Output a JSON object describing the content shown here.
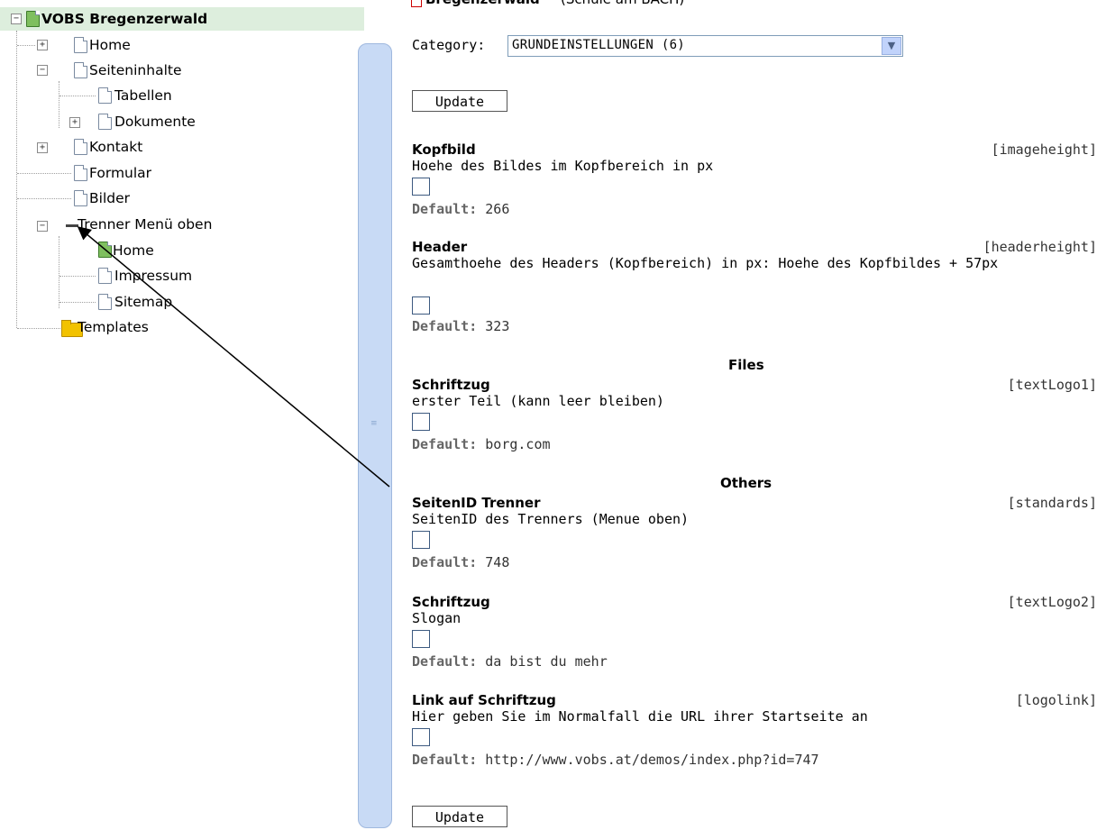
{
  "tree": {
    "root": "VOBS Bregenzerwald",
    "items": [
      {
        "label": "Home"
      },
      {
        "label": "Seiteninhalte"
      },
      {
        "label": "Tabellen"
      },
      {
        "label": "Dokumente"
      },
      {
        "label": "Kontakt"
      },
      {
        "label": "Formular"
      },
      {
        "label": "Bilder"
      },
      {
        "label": "Trenner Menü oben"
      },
      {
        "label": "Home"
      },
      {
        "label": "Impressum"
      },
      {
        "label": "Sitemap"
      },
      {
        "label": "Templates"
      }
    ]
  },
  "content": {
    "top_title": "Bregenzerwald",
    "top_title_suffix": "(Schule am BACH)",
    "category_label": "Category:",
    "category_value": "GRUNDEINSTELLUNGEN (6)",
    "update_label": "Update",
    "entries": [
      {
        "title": "Kopfbild",
        "key": "[imageheight]",
        "desc": "Hoehe des Bildes im Kopfbereich in px",
        "default_label": "Default:",
        "default_value": "266"
      },
      {
        "title": "Header",
        "key": "[headerheight]",
        "desc": "Gesamthoehe des Headers (Kopfbereich) in px: Hoehe des Kopfbildes + 57px",
        "default_label": "Default:",
        "default_value": "323"
      },
      {
        "title": "Schriftzug",
        "key": "[textLogo1]",
        "desc": "erster Teil (kann leer bleiben)",
        "default_label": "Default:",
        "default_value": "borg.com"
      },
      {
        "title": "SeitenID Trenner",
        "key": "[standards]",
        "desc": "SeitenID des Trenners (Menue oben)",
        "default_label": "Default:",
        "default_value": "748"
      },
      {
        "title": "Schriftzug",
        "key": "[textLogo2]",
        "desc": "Slogan",
        "default_label": "Default:",
        "default_value": "da bist du mehr"
      },
      {
        "title": "Link auf Schriftzug",
        "key": "[logolink]",
        "desc": "Hier geben Sie im Normalfall die URL ihrer Startseite an",
        "default_label": "Default:",
        "default_value": "http://www.vobs.at/demos/index.php?id=747"
      }
    ],
    "sections": {
      "files": "Files",
      "others": "Others"
    }
  }
}
